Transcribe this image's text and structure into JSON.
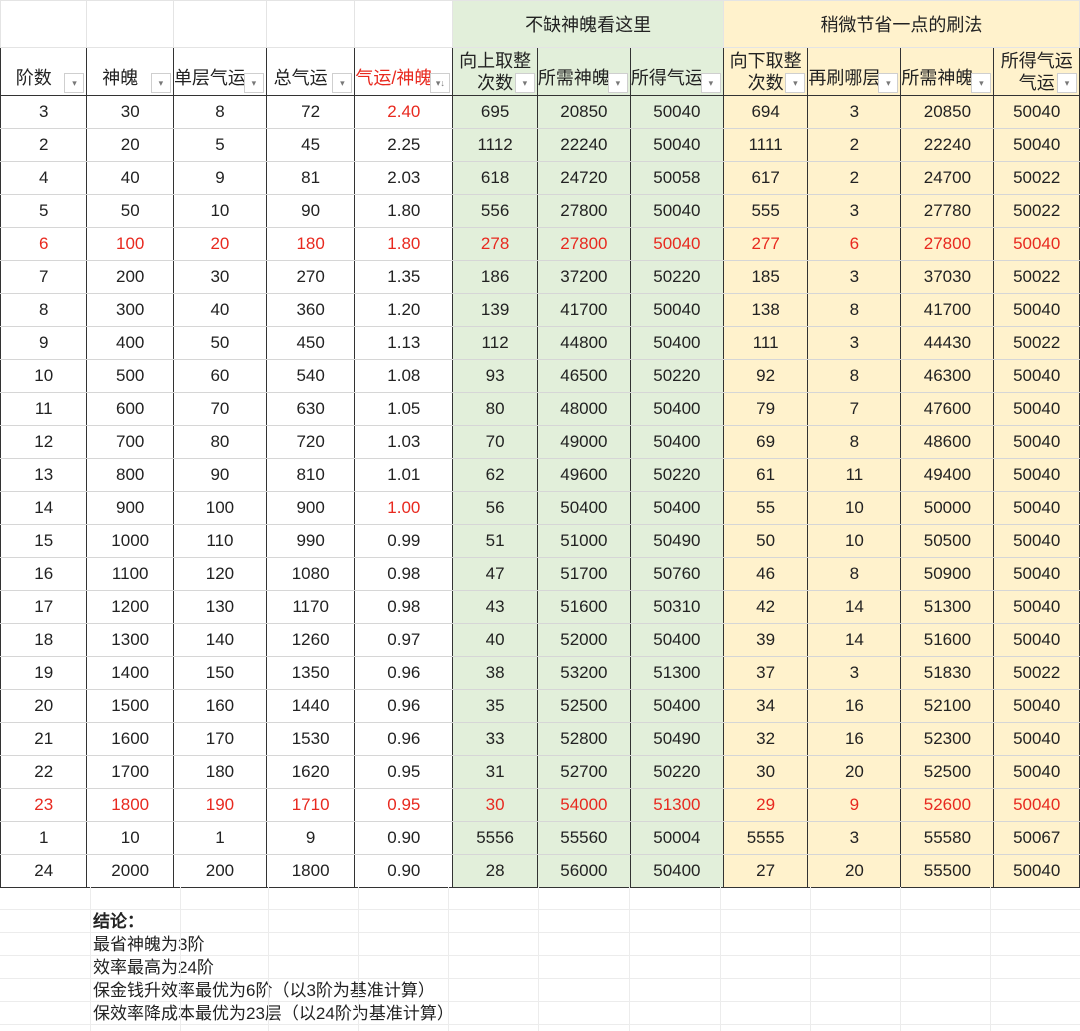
{
  "group_headers": {
    "green": "不缺神魄看这里",
    "yellow": "稍微节省一点的刷法"
  },
  "headers": [
    "阶数",
    "神魄",
    "单层气运",
    "总气运",
    "气运/神魄",
    "向上取整次数",
    "所需神魄",
    "所得气运",
    "向下取整次数",
    "再刷哪层",
    "所需神魄",
    "所得气运气运"
  ],
  "header_lines": {
    "c5": [
      "向上取整",
      "次数"
    ],
    "c8": [
      "向下取整",
      "次数"
    ],
    "c11": [
      "所得气运",
      "气运"
    ]
  },
  "rows": [
    [
      "3",
      "30",
      "8",
      "72",
      "2.40",
      "695",
      "20850",
      "50040",
      "694",
      "3",
      "20850",
      "50040"
    ],
    [
      "2",
      "20",
      "5",
      "45",
      "2.25",
      "1112",
      "22240",
      "50040",
      "1111",
      "2",
      "22240",
      "50040"
    ],
    [
      "4",
      "40",
      "9",
      "81",
      "2.03",
      "618",
      "24720",
      "50058",
      "617",
      "2",
      "24700",
      "50022"
    ],
    [
      "5",
      "50",
      "10",
      "90",
      "1.80",
      "556",
      "27800",
      "50040",
      "555",
      "3",
      "27780",
      "50022"
    ],
    [
      "6",
      "100",
      "20",
      "180",
      "1.80",
      "278",
      "27800",
      "50040",
      "277",
      "6",
      "27800",
      "50040"
    ],
    [
      "7",
      "200",
      "30",
      "270",
      "1.35",
      "186",
      "37200",
      "50220",
      "185",
      "3",
      "37030",
      "50022"
    ],
    [
      "8",
      "300",
      "40",
      "360",
      "1.20",
      "139",
      "41700",
      "50040",
      "138",
      "8",
      "41700",
      "50040"
    ],
    [
      "9",
      "400",
      "50",
      "450",
      "1.13",
      "112",
      "44800",
      "50400",
      "111",
      "3",
      "44430",
      "50022"
    ],
    [
      "10",
      "500",
      "60",
      "540",
      "1.08",
      "93",
      "46500",
      "50220",
      "92",
      "8",
      "46300",
      "50040"
    ],
    [
      "11",
      "600",
      "70",
      "630",
      "1.05",
      "80",
      "48000",
      "50400",
      "79",
      "7",
      "47600",
      "50040"
    ],
    [
      "12",
      "700",
      "80",
      "720",
      "1.03",
      "70",
      "49000",
      "50400",
      "69",
      "8",
      "48600",
      "50040"
    ],
    [
      "13",
      "800",
      "90",
      "810",
      "1.01",
      "62",
      "49600",
      "50220",
      "61",
      "11",
      "49400",
      "50040"
    ],
    [
      "14",
      "900",
      "100",
      "900",
      "1.00",
      "56",
      "50400",
      "50400",
      "55",
      "10",
      "50000",
      "50040"
    ],
    [
      "15",
      "1000",
      "110",
      "990",
      "0.99",
      "51",
      "51000",
      "50490",
      "50",
      "10",
      "50500",
      "50040"
    ],
    [
      "16",
      "1100",
      "120",
      "1080",
      "0.98",
      "47",
      "51700",
      "50760",
      "46",
      "8",
      "50900",
      "50040"
    ],
    [
      "17",
      "1200",
      "130",
      "1170",
      "0.98",
      "43",
      "51600",
      "50310",
      "42",
      "14",
      "51300",
      "50040"
    ],
    [
      "18",
      "1300",
      "140",
      "1260",
      "0.97",
      "40",
      "52000",
      "50400",
      "39",
      "14",
      "51600",
      "50040"
    ],
    [
      "19",
      "1400",
      "150",
      "1350",
      "0.96",
      "38",
      "53200",
      "51300",
      "37",
      "3",
      "51830",
      "50022"
    ],
    [
      "20",
      "1500",
      "160",
      "1440",
      "0.96",
      "35",
      "52500",
      "50400",
      "34",
      "16",
      "52100",
      "50040"
    ],
    [
      "21",
      "1600",
      "170",
      "1530",
      "0.96",
      "33",
      "52800",
      "50490",
      "32",
      "16",
      "52300",
      "50040"
    ],
    [
      "22",
      "1700",
      "180",
      "1620",
      "0.95",
      "31",
      "52700",
      "50220",
      "30",
      "20",
      "52500",
      "50040"
    ],
    [
      "23",
      "1800",
      "190",
      "1710",
      "0.95",
      "30",
      "54000",
      "51300",
      "29",
      "9",
      "52600",
      "50040"
    ],
    [
      "1",
      "10",
      "1",
      "9",
      "0.90",
      "5556",
      "55560",
      "50004",
      "5555",
      "3",
      "55580",
      "50067"
    ],
    [
      "24",
      "2000",
      "200",
      "1800",
      "0.90",
      "28",
      "56000",
      "50400",
      "27",
      "20",
      "55500",
      "50040"
    ]
  ],
  "red_rows": [
    4,
    21
  ],
  "red_cells": [
    [
      0,
      4
    ],
    [
      12,
      4
    ]
  ],
  "conclusion": {
    "title": "结论：",
    "lines": [
      "最省神魄为3阶",
      "效率最高为24阶",
      "保金钱升效率最优为6阶（以3阶为基准计算）",
      "保效率降成本最优为23层（以24阶为基准计算）"
    ]
  },
  "colors": {
    "green": "#e2efda",
    "yellow": "#fff2cc",
    "red": "#e8291f"
  }
}
